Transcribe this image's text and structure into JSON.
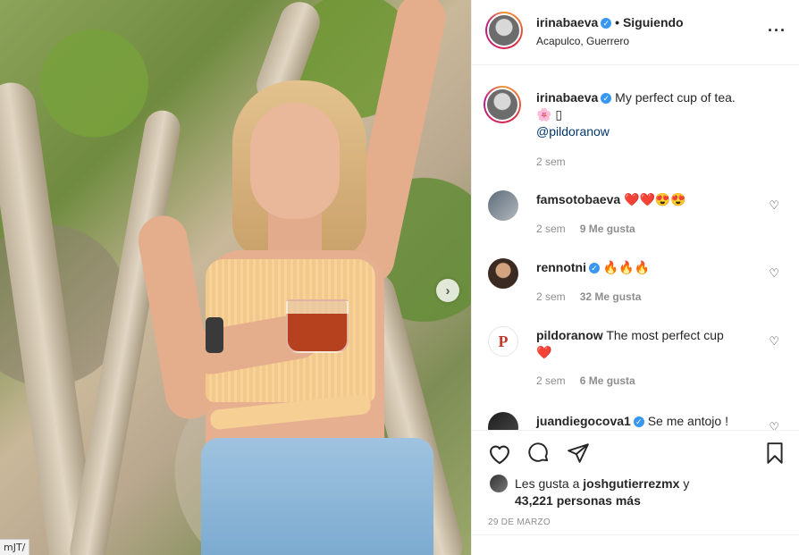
{
  "post": {
    "author": "irinabaeva",
    "follow_state": "• Siguiendo",
    "location": "Acapulco, Guerrero",
    "more_icon": "more-horizontal-icon",
    "next_icon": "chevron-right-icon",
    "url_tag": "mJT/"
  },
  "caption": {
    "user": "irinabaeva",
    "text": "My perfect cup of tea.",
    "emoji": "🌸 ▯",
    "mention": "@pildoranow",
    "time": "2 sem"
  },
  "comments": [
    {
      "user": "famsotobaeva",
      "verified": false,
      "text": "❤️❤️😍😍",
      "time": "2 sem",
      "likes": "9 Me gusta"
    },
    {
      "user": "rennotni",
      "verified": true,
      "text": "🔥🔥🔥",
      "time": "2 sem",
      "likes": "32 Me gusta"
    },
    {
      "user": "pildoranow",
      "verified": false,
      "text": "The most perfect cup",
      "text2": "❤️",
      "time": "2 sem",
      "likes": "6 Me gusta"
    },
    {
      "user": "juandiegocova1",
      "verified": true,
      "text": "Se me antojo !"
    }
  ],
  "actions": {
    "like_icon": "heart-outline-icon",
    "comment_icon": "comment-icon",
    "share_icon": "paper-plane-icon",
    "save_icon": "bookmark-icon"
  },
  "likes": {
    "prefix": "Les gusta a",
    "user": "joshgutierrezmx",
    "mid": "y",
    "count": "43,221 personas más"
  },
  "date": "29 DE MARZO",
  "colors": {
    "verified": "#3897f0",
    "link": "#00376b",
    "heart": "#ed4956",
    "muted": "#8e8e8e"
  }
}
